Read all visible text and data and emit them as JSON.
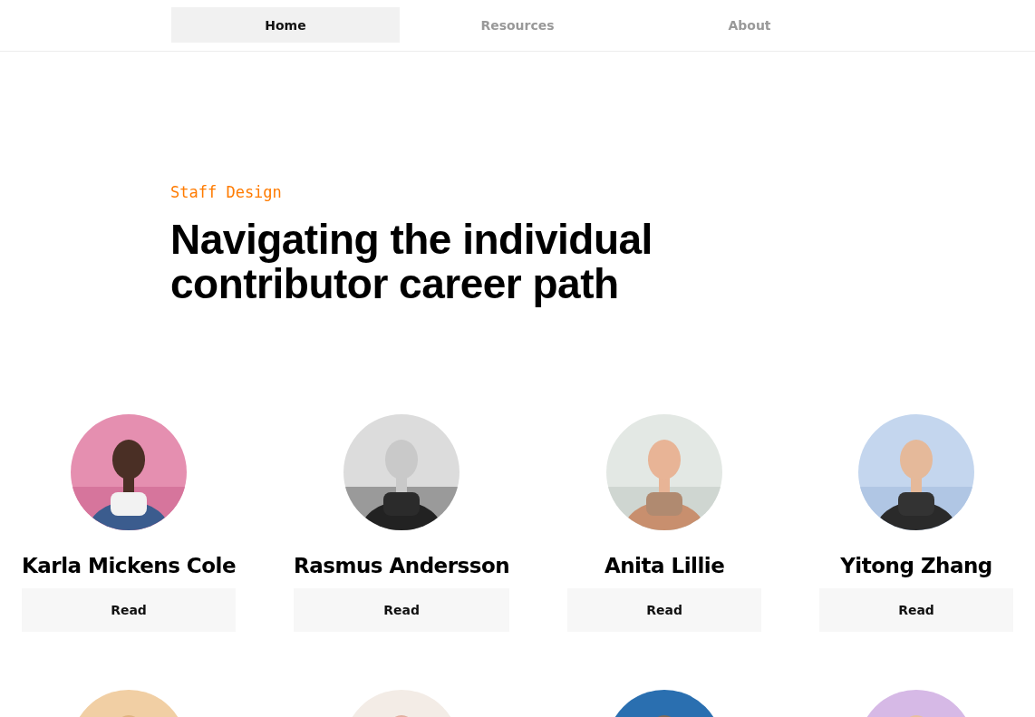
{
  "nav": [
    {
      "label": "Home",
      "selected": true
    },
    {
      "label": "Resources",
      "selected": false
    },
    {
      "label": "About",
      "selected": false
    }
  ],
  "hero": {
    "category": "Staff Design",
    "title": "Navigating the individual contributor career path"
  },
  "people": [
    {
      "kind": "person",
      "name": "Karla Mickens Cole",
      "action": "Read"
    },
    {
      "kind": "person",
      "name": "Rasmus Andersson",
      "action": "Read"
    },
    {
      "kind": "person",
      "name": "Anita Lillie",
      "action": "Read"
    },
    {
      "kind": "person",
      "name": "Yitong Zhang",
      "action": "Read"
    },
    {
      "kind": "picture"
    },
    {
      "kind": "picture"
    },
    {
      "kind": "picture"
    },
    {
      "kind": "picture"
    }
  ]
}
